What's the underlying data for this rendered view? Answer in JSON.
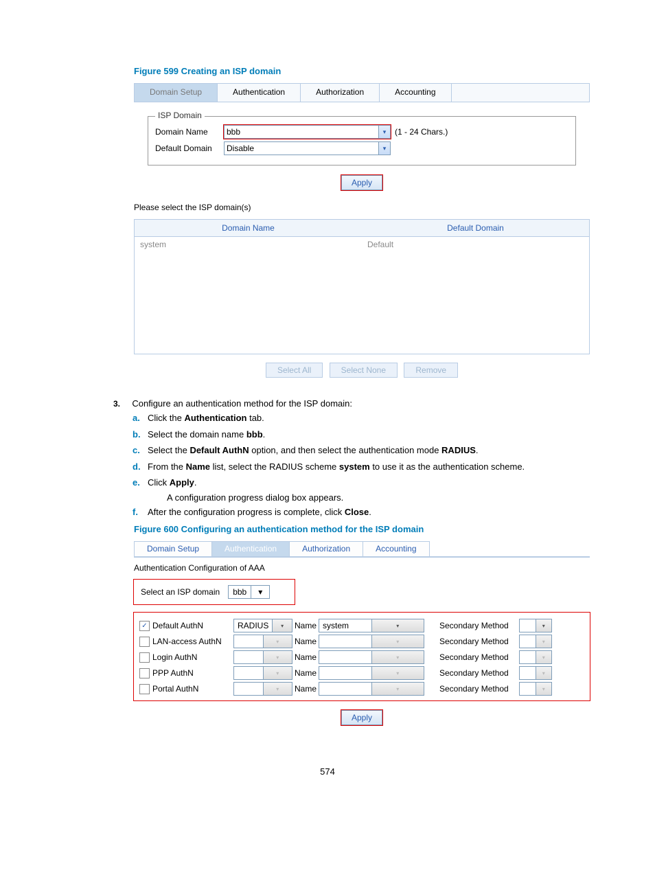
{
  "figure599": {
    "title": "Figure 599 Creating an ISP domain",
    "tabs": [
      "Domain Setup",
      "Authentication",
      "Authorization",
      "Accounting"
    ],
    "fieldset_legend": "ISP Domain",
    "domain_name_label": "Domain Name",
    "domain_name_value": "bbb",
    "domain_name_hint": "(1 - 24 Chars.)",
    "default_domain_label": "Default Domain",
    "default_domain_value": "Disable",
    "apply_label": "Apply",
    "please_select": "Please select the ISP domain(s)",
    "table_headers": [
      "Domain Name",
      "Default Domain"
    ],
    "table_row": {
      "name": "system",
      "def": "Default"
    },
    "buttons": [
      "Select All",
      "Select None",
      "Remove"
    ]
  },
  "instructions": {
    "main_num": "3.",
    "main_text": "Configure an authentication method for the ISP domain:",
    "steps": [
      {
        "n": "a.",
        "html": "Click the <b>Authentication</b> tab."
      },
      {
        "n": "b.",
        "html": "Select the domain name <b>bbb</b>."
      },
      {
        "n": "c.",
        "html": "Select the <b>Default AuthN</b> option, and then select the authentication mode <b>RADIUS</b>."
      },
      {
        "n": "d.",
        "html": "From the <b>Name</b> list, select the RADIUS scheme <b>system</b> to use it as the authentication scheme."
      },
      {
        "n": "e.",
        "html": "Click <b>Apply</b>."
      },
      {
        "n": "f.",
        "html": "After the configuration progress is complete, click <b>Close</b>."
      }
    ],
    "inset": "A configuration progress dialog box appears."
  },
  "figure600": {
    "title": "Figure 600 Configuring an authentication method for the ISP domain",
    "tabs": [
      "Domain Setup",
      "Authentication",
      "Authorization",
      "Accounting"
    ],
    "aaa_label": "Authentication Configuration of AAA",
    "select_label": "Select an ISP domain",
    "select_value": "bbb",
    "name_col": "Name",
    "secondary_col": "Secondary Method",
    "rows": [
      {
        "label": "Default AuthN",
        "checked": true,
        "method": "RADIUS",
        "name": "system"
      },
      {
        "label": "LAN-access AuthN",
        "checked": false,
        "method": "",
        "name": ""
      },
      {
        "label": "Login AuthN",
        "checked": false,
        "method": "",
        "name": ""
      },
      {
        "label": "PPP AuthN",
        "checked": false,
        "method": "",
        "name": ""
      },
      {
        "label": "Portal AuthN",
        "checked": false,
        "method": "",
        "name": ""
      }
    ],
    "apply_label": "Apply"
  },
  "page_number": "574"
}
